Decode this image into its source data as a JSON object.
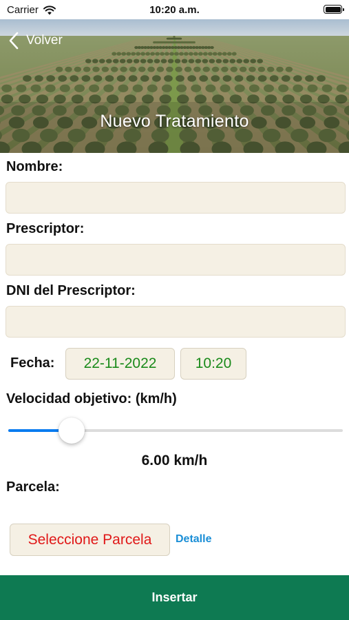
{
  "status_bar": {
    "carrier": "Carrier",
    "time": "10:20 a.m.",
    "wifi_icon": "wifi-icon",
    "battery_icon": "battery-icon",
    "battery_level": 1.0
  },
  "header": {
    "back_label": "Volver",
    "back_icon": "chevron-left-icon",
    "title": "Nuevo Tratamiento",
    "background": "olive-grove-photo"
  },
  "form": {
    "nombre": {
      "label": "Nombre:",
      "value": ""
    },
    "prescriptor": {
      "label": "Prescriptor:",
      "value": ""
    },
    "dni": {
      "label": "DNI del Prescriptor:",
      "value": ""
    },
    "fecha": {
      "label": "Fecha:",
      "date": "22-11-2022",
      "time": "10:20"
    },
    "velocidad": {
      "label": "Velocidad objetivo: (km/h)",
      "display": "6.00 km/h",
      "value": 6.0,
      "slider_fraction": 0.19
    },
    "parcela": {
      "label": "Parcela:",
      "select_label": "Seleccione Parcela",
      "detail_link": "Detalle"
    }
  },
  "actions": {
    "insert_label": "Insertar"
  },
  "colors": {
    "primary_green": "#0e7a52",
    "input_bg": "#f5f0e4",
    "date_text": "#1a8a1a",
    "select_text": "#e01818",
    "link": "#1a8ed6",
    "slider_fill": "#0a7cf0"
  }
}
